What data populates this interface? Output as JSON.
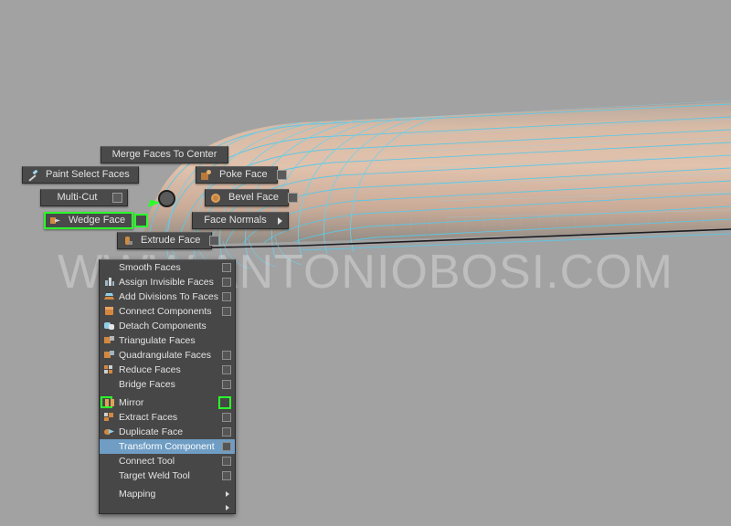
{
  "viewport": {
    "background_color": "#a2a2a2",
    "wireframe_color": "#59c8e8",
    "surface_color": "#d8b49e",
    "pivot_marker": "pivot-point",
    "cursor": "green-arrow-cursor"
  },
  "watermark": {
    "text": "WWW.ANTONIOBOSI.COM"
  },
  "marking_menu": {
    "buttons": [
      {
        "label": "Merge Faces To Center",
        "icon": null,
        "option_box": false,
        "arrow": false,
        "selected": false
      },
      {
        "label": "Paint Select Faces",
        "icon": "paint-icon",
        "option_box": false,
        "arrow": false,
        "selected": false
      },
      {
        "label": "Poke Face",
        "icon": "poke-icon",
        "option_box": true,
        "arrow": false,
        "selected": false
      },
      {
        "label": "Multi-Cut",
        "icon": null,
        "option_box": true,
        "arrow": false,
        "selected": false
      },
      {
        "label": "Bevel Face",
        "icon": "bevel-icon",
        "option_box": true,
        "arrow": false,
        "selected": false
      },
      {
        "label": "Wedge Face",
        "icon": "wedge-icon",
        "option_box": true,
        "arrow": false,
        "selected": true
      },
      {
        "label": "Face Normals",
        "icon": null,
        "option_box": false,
        "arrow": true,
        "selected": false
      },
      {
        "label": "Extrude Face",
        "icon": "extrude-icon",
        "option_box": true,
        "arrow": false,
        "selected": false
      }
    ],
    "highlight_color": "#2bff2b"
  },
  "dropdown_menu": {
    "highlight_color": "#6f9dc4",
    "items": [
      {
        "label": "Smooth Faces",
        "icon": null,
        "option_box": true,
        "arrow": false,
        "highlighted": false,
        "icon_selected": false,
        "box_selected": false
      },
      {
        "label": "Assign Invisible Faces",
        "icon": "grid-icon",
        "option_box": true,
        "arrow": false,
        "highlighted": false,
        "icon_selected": false,
        "box_selected": false
      },
      {
        "label": "Add Divisions To Faces",
        "icon": "layers-icon",
        "option_box": true,
        "arrow": false,
        "highlighted": false,
        "icon_selected": false,
        "box_selected": false
      },
      {
        "label": "Connect Components",
        "icon": "cube-icon",
        "option_box": true,
        "arrow": false,
        "highlighted": false,
        "icon_selected": false,
        "box_selected": false
      },
      {
        "label": "Detach Components",
        "icon": "detach-icon",
        "option_box": false,
        "arrow": false,
        "highlighted": false,
        "icon_selected": false,
        "box_selected": false
      },
      {
        "label": "Triangulate Faces",
        "icon": "triangulate-icon",
        "option_box": false,
        "arrow": false,
        "highlighted": false,
        "icon_selected": false,
        "box_selected": false
      },
      {
        "label": "Quadrangulate Faces",
        "icon": "quadrangulate-icon",
        "option_box": true,
        "arrow": false,
        "highlighted": false,
        "icon_selected": false,
        "box_selected": false
      },
      {
        "label": "Reduce Faces",
        "icon": "reduce-icon",
        "option_box": true,
        "arrow": false,
        "highlighted": false,
        "icon_selected": false,
        "box_selected": false
      },
      {
        "label": "Bridge Faces",
        "icon": null,
        "option_box": true,
        "arrow": false,
        "highlighted": false,
        "icon_selected": false,
        "box_selected": false
      },
      {
        "label": "Mirror",
        "icon": "mirror-icon",
        "option_box": true,
        "arrow": false,
        "highlighted": false,
        "icon_selected": true,
        "box_selected": true
      },
      {
        "label": "Extract Faces",
        "icon": "extract-icon",
        "option_box": true,
        "arrow": false,
        "highlighted": false,
        "icon_selected": false,
        "box_selected": false
      },
      {
        "label": "Duplicate Face",
        "icon": "duplicate-icon",
        "option_box": true,
        "arrow": false,
        "highlighted": false,
        "icon_selected": false,
        "box_selected": false
      },
      {
        "label": "Transform Component",
        "icon": null,
        "option_box": true,
        "arrow": false,
        "highlighted": true,
        "icon_selected": false,
        "box_selected": false
      },
      {
        "label": "Connect Tool",
        "icon": null,
        "option_box": true,
        "arrow": false,
        "highlighted": false,
        "icon_selected": false,
        "box_selected": false
      },
      {
        "label": "Target Weld Tool",
        "icon": null,
        "option_box": true,
        "arrow": false,
        "highlighted": false,
        "icon_selected": false,
        "box_selected": false
      },
      {
        "label": "Mapping",
        "icon": null,
        "option_box": false,
        "arrow": true,
        "highlighted": false,
        "icon_selected": false,
        "box_selected": false
      }
    ]
  }
}
